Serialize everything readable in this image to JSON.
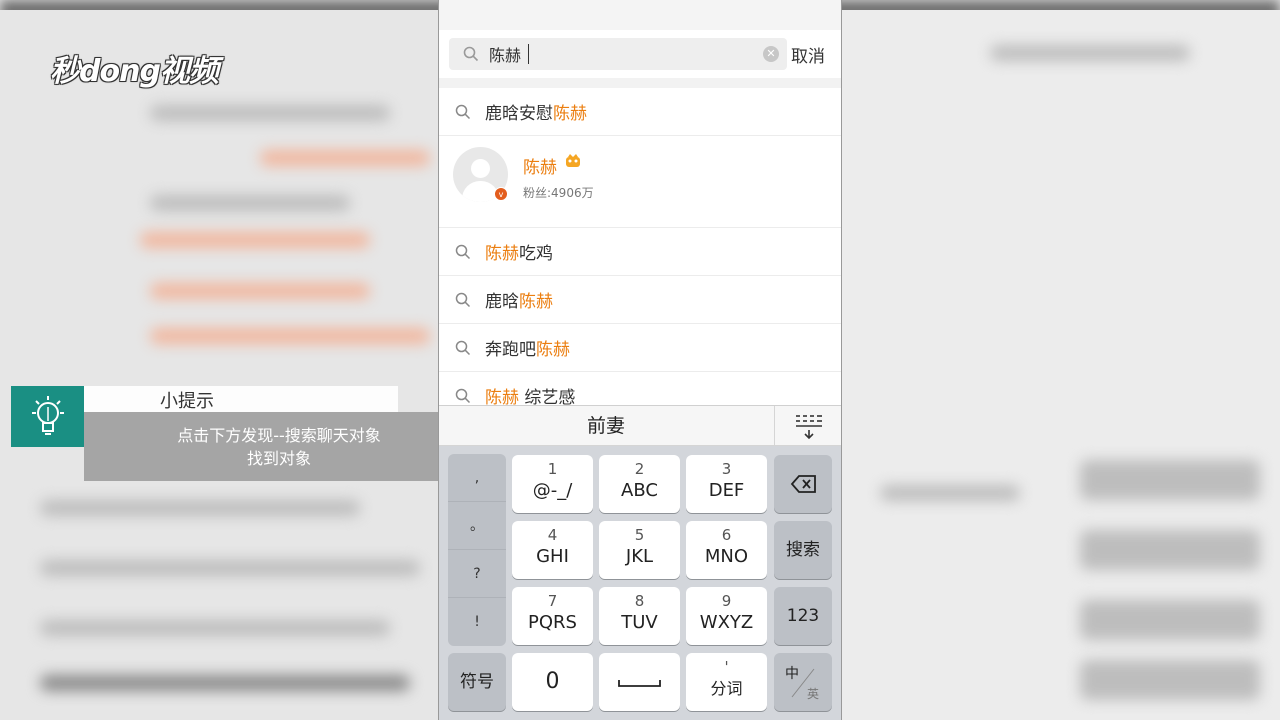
{
  "branding": {
    "logo": "秒dong视频"
  },
  "tip": {
    "title": "小提示",
    "line1": "点击下方发现--搜索聊天对象",
    "line2": "找到对象"
  },
  "search": {
    "query": "陈赫",
    "cancel_label": "取消"
  },
  "results": [
    {
      "prefix": "鹿晗安慰",
      "highlight": "陈赫",
      "suffix": ""
    },
    {
      "prefix": "",
      "highlight": "陈赫",
      "suffix": "吃鸡"
    },
    {
      "prefix": "鹿晗",
      "highlight": "陈赫",
      "suffix": ""
    },
    {
      "prefix": "奔跑吧",
      "highlight": "陈赫",
      "suffix": ""
    },
    {
      "prefix": "",
      "highlight": "陈赫",
      "suffix": " 综艺感"
    }
  ],
  "user_result": {
    "name": "陈赫",
    "fans": "粉丝:4906万",
    "verified_icon": "v-badge-icon",
    "crown_icon": "crown-icon"
  },
  "keyboard": {
    "candidate": "前妻",
    "punctuation": [
      ",",
      "。",
      "?",
      "!"
    ],
    "keys": [
      {
        "num": "1",
        "letters": "@-_/"
      },
      {
        "num": "2",
        "letters": "ABC"
      },
      {
        "num": "3",
        "letters": "DEF"
      },
      {
        "num": "4",
        "letters": "GHI"
      },
      {
        "num": "5",
        "letters": "JKL"
      },
      {
        "num": "6",
        "letters": "MNO"
      },
      {
        "num": "7",
        "letters": "PQRS"
      },
      {
        "num": "8",
        "letters": "TUV"
      },
      {
        "num": "9",
        "letters": "WXYZ"
      }
    ],
    "search_key": "搜索",
    "num_key": "123",
    "symbol_key": "符号",
    "zero_key": "0",
    "segment_key_top": "'",
    "segment_key": "分词",
    "lang_zh": "中",
    "lang_en": "英"
  },
  "colors": {
    "highlight": "#eb7e10",
    "tip_accent": "#1a8f83"
  }
}
